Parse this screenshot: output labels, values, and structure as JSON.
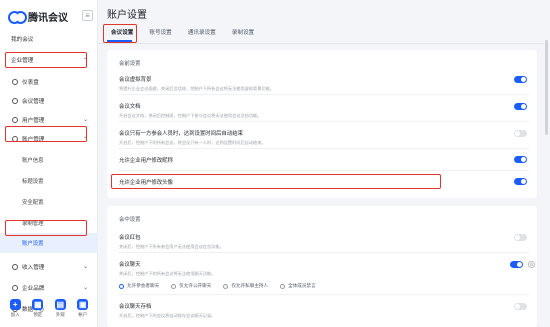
{
  "app": {
    "name": "腾讯会议",
    "collapse_glyph": "≡"
  },
  "sidebar": {
    "items": [
      {
        "label": "我的会议",
        "icon": "none"
      },
      {
        "label": "企业管理",
        "icon": "chevron-up-icon",
        "expanded": true
      },
      {
        "label": "仪表盘",
        "icon": "gauge-icon",
        "sub": true
      },
      {
        "label": "会议管理",
        "icon": "meeting-icon",
        "sub": true
      },
      {
        "label": "用户管理",
        "icon": "user-icon",
        "chevron": "⌄"
      },
      {
        "label": "账户管理",
        "icon": "account-icon",
        "chevron": "⌃"
      },
      {
        "label": "账户信息",
        "sub2": true
      },
      {
        "label": "标题设置",
        "sub2": true
      },
      {
        "label": "安全配置",
        "sub2": true
      },
      {
        "label": "录制管理",
        "sub2": true
      },
      {
        "label": "账户设置",
        "sub2": true,
        "active": true
      },
      {
        "label": "收入管理",
        "icon": "income-icon",
        "chevron": "⌄"
      },
      {
        "label": "企业品牌",
        "icon": "brand-icon",
        "chevron": "⌄"
      },
      {
        "label": "数据中心",
        "icon": "data-icon",
        "chevron": "⌄"
      }
    ],
    "bottom": [
      {
        "label": "加入",
        "glyph": "+"
      },
      {
        "label": "预定",
        "glyph": "▦"
      },
      {
        "label": "外观",
        "glyph": "▤"
      },
      {
        "label": "帐户",
        "glyph": "▣"
      }
    ]
  },
  "main": {
    "title": "账户设置",
    "tabs": [
      "会议设置",
      "账号设置",
      "通讯录设置",
      "录制设置"
    ],
    "active_tab": 0,
    "section1": {
      "title": "会前设置",
      "rows": [
        {
          "title": "会议虚拟背景",
          "desc": "将提升企业会议面貌，关闭后会话帧，控制户下所有会议将无法使用虚拟背景功能。",
          "on": true
        },
        {
          "title": "会议文档",
          "desc": "开启会议文档，关闭后控制面，控制户下参与会议将无法使用会议文档功能。",
          "on": true
        },
        {
          "title": "会议只有一方参会人员时，达到设置时间后自动结束",
          "desc": "开启后，控制户下的所有会议，将会议只有一人时，达到设置时间后自动结束。",
          "on": false
        },
        {
          "title": "允许企业用户修改昵称",
          "desc": "",
          "on": true
        },
        {
          "title": "允许企业用户修改头像",
          "desc": "",
          "on": true
        }
      ]
    },
    "section2": {
      "title": "会中设置",
      "rows": [
        {
          "title": "会议红包",
          "desc": "关闭后，控制户下所有参会用户无法使用会议红包功能。",
          "on": false
        },
        {
          "title": "会议聊天",
          "desc": "关闭后，控制户下的所有会议将无法使用聊天功能。",
          "on": true
        },
        {
          "title": "会议聊天存档",
          "desc": "开启后，控制户下的会议将自动保存会议聊天记录。",
          "on": false
        }
      ],
      "radios": [
        "允许参会者聊天",
        "仅允许公开聊天",
        "仅允许私聊主持人",
        "全体成员禁言"
      ],
      "radio_selected": 0
    }
  },
  "colors": {
    "accent": "#1a5cff",
    "highlight": "#e0352b"
  }
}
